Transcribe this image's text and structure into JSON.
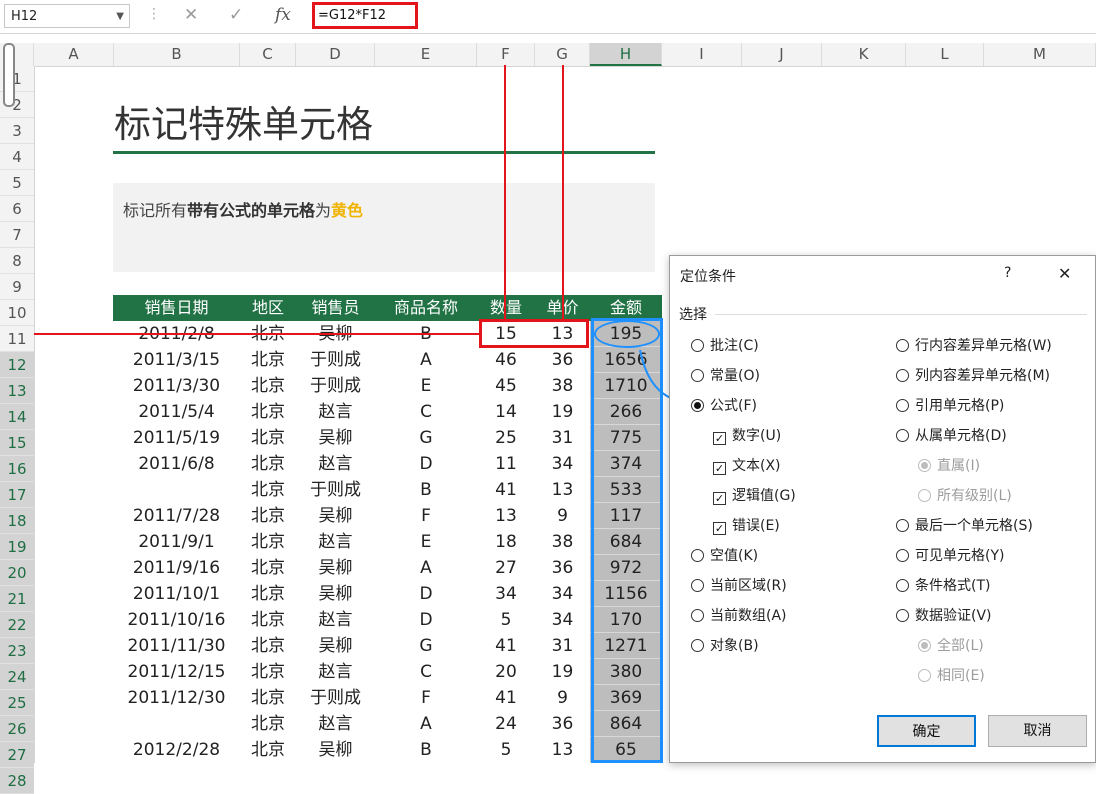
{
  "formula_bar": {
    "name_box": "H12",
    "formula": "=G12*F12",
    "cancel_icon": "✕",
    "enter_icon": "✓",
    "fx_icon": "fx"
  },
  "columns": [
    "A",
    "B",
    "C",
    "D",
    "E",
    "F",
    "G",
    "H",
    "I",
    "J",
    "K",
    "L",
    "M"
  ],
  "rows": [
    "1",
    "2",
    "3",
    "4",
    "5",
    "6",
    "7",
    "8",
    "9",
    "10",
    "11",
    "12",
    "13",
    "14",
    "15",
    "16",
    "17",
    "18",
    "19",
    "20",
    "21",
    "22",
    "23",
    "24",
    "25",
    "26",
    "27",
    "28"
  ],
  "sheet": {
    "title": "标记特殊单元格",
    "note_prefix": "标记所有",
    "note_bold": "带有公式的单元格",
    "note_mid": "为",
    "note_highlight": "黄色"
  },
  "table": {
    "headers": [
      "销售日期",
      "地区",
      "销售员",
      "商品名称",
      "数量",
      "单价",
      "金额"
    ],
    "rows": [
      [
        "2011/2/8",
        "北京",
        "吴柳",
        "B",
        "15",
        "13",
        "195"
      ],
      [
        "2011/3/15",
        "北京",
        "于则成",
        "A",
        "46",
        "36",
        "1656"
      ],
      [
        "2011/3/30",
        "北京",
        "于则成",
        "E",
        "45",
        "38",
        "1710"
      ],
      [
        "2011/5/4",
        "北京",
        "赵言",
        "C",
        "14",
        "19",
        "266"
      ],
      [
        "2011/5/19",
        "北京",
        "吴柳",
        "G",
        "25",
        "31",
        "775"
      ],
      [
        "2011/6/8",
        "北京",
        "赵言",
        "D",
        "11",
        "34",
        "374"
      ],
      [
        "",
        "北京",
        "于则成",
        "B",
        "41",
        "13",
        "533"
      ],
      [
        "2011/7/28",
        "北京",
        "吴柳",
        "F",
        "13",
        "9",
        "117"
      ],
      [
        "2011/9/1",
        "北京",
        "赵言",
        "E",
        "18",
        "38",
        "684"
      ],
      [
        "2011/9/16",
        "北京",
        "吴柳",
        "A",
        "27",
        "36",
        "972"
      ],
      [
        "2011/10/1",
        "北京",
        "吴柳",
        "D",
        "34",
        "34",
        "1156"
      ],
      [
        "2011/10/16",
        "北京",
        "赵言",
        "D",
        "5",
        "34",
        "170"
      ],
      [
        "2011/11/30",
        "北京",
        "吴柳",
        "G",
        "41",
        "31",
        "1271"
      ],
      [
        "2011/12/15",
        "北京",
        "赵言",
        "C",
        "20",
        "19",
        "380"
      ],
      [
        "2011/12/30",
        "北京",
        "于则成",
        "F",
        "41",
        "9",
        "369"
      ],
      [
        "",
        "北京",
        "赵言",
        "A",
        "24",
        "36",
        "864"
      ],
      [
        "2012/2/28",
        "北京",
        "吴柳",
        "B",
        "5",
        "13",
        "65"
      ]
    ]
  },
  "dialog": {
    "title": "定位条件",
    "help": "?",
    "close": "✕",
    "group": "选择",
    "left": [
      {
        "label": "批注(C)",
        "kind": "radio",
        "on": false,
        "dis": false
      },
      {
        "label": "常量(O)",
        "kind": "radio",
        "on": false,
        "dis": false
      },
      {
        "label": "公式(F)",
        "kind": "radio",
        "on": true,
        "dis": false
      },
      {
        "label": "数字(U)",
        "kind": "check",
        "on": true,
        "dis": false
      },
      {
        "label": "文本(X)",
        "kind": "check",
        "on": true,
        "dis": false
      },
      {
        "label": "逻辑值(G)",
        "kind": "check",
        "on": true,
        "dis": false
      },
      {
        "label": "错误(E)",
        "kind": "check",
        "on": true,
        "dis": false
      },
      {
        "label": "空值(K)",
        "kind": "radio",
        "on": false,
        "dis": false
      },
      {
        "label": "当前区域(R)",
        "kind": "radio",
        "on": false,
        "dis": false
      },
      {
        "label": "当前数组(A)",
        "kind": "radio",
        "on": false,
        "dis": false
      },
      {
        "label": "对象(B)",
        "kind": "radio",
        "on": false,
        "dis": false
      }
    ],
    "right": [
      {
        "label": "行内容差异单元格(W)",
        "kind": "radio",
        "on": false,
        "dis": false
      },
      {
        "label": "列内容差异单元格(M)",
        "kind": "radio",
        "on": false,
        "dis": false
      },
      {
        "label": "引用单元格(P)",
        "kind": "radio",
        "on": false,
        "dis": false
      },
      {
        "label": "从属单元格(D)",
        "kind": "radio",
        "on": false,
        "dis": false
      },
      {
        "label": "直属(I)",
        "kind": "radio",
        "on": true,
        "dis": true
      },
      {
        "label": "所有级别(L)",
        "kind": "radio",
        "on": false,
        "dis": true
      },
      {
        "label": "最后一个单元格(S)",
        "kind": "radio",
        "on": false,
        "dis": false
      },
      {
        "label": "可见单元格(Y)",
        "kind": "radio",
        "on": false,
        "dis": false
      },
      {
        "label": "条件格式(T)",
        "kind": "radio",
        "on": false,
        "dis": false
      },
      {
        "label": "数据验证(V)",
        "kind": "radio",
        "on": false,
        "dis": false
      },
      {
        "label": "全部(L)",
        "kind": "radio",
        "on": true,
        "dis": true
      },
      {
        "label": "相同(E)",
        "kind": "radio",
        "on": false,
        "dis": true
      }
    ],
    "ok": "确定",
    "cancel": "取消"
  },
  "colors": {
    "accent_green": "#217346",
    "highlight_red": "#e3141a",
    "highlight_blue": "#1e90ff",
    "note_yellow": "#f0b400"
  }
}
